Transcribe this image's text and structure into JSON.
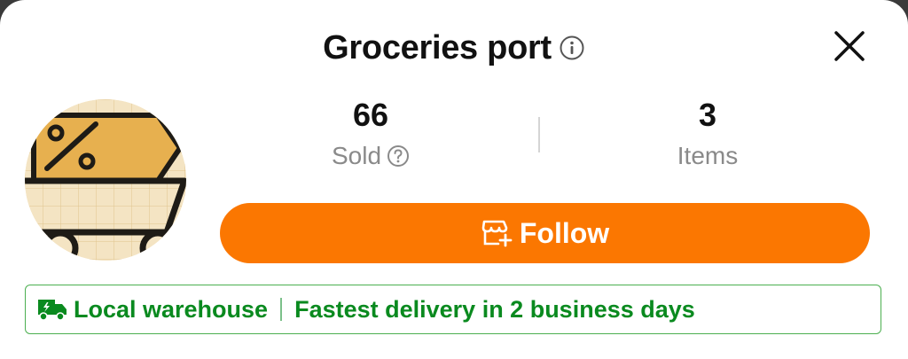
{
  "store": {
    "name": "Groceries port",
    "info_icon": "info-icon",
    "close_icon": "close-icon",
    "avatar_icon": "shopping-cart-discount-icon"
  },
  "stats": {
    "sold": {
      "value": "66",
      "label": "Sold",
      "help_icon": "question-icon"
    },
    "items": {
      "value": "3",
      "label": "Items"
    }
  },
  "follow_button": {
    "label": "Follow",
    "icon": "store-add-icon",
    "color": "#fb7701"
  },
  "banner": {
    "icon": "delivery-truck-icon",
    "tag": "Local warehouse",
    "message": "Fastest delivery in 2 business days",
    "color": "#0a8a1f"
  }
}
